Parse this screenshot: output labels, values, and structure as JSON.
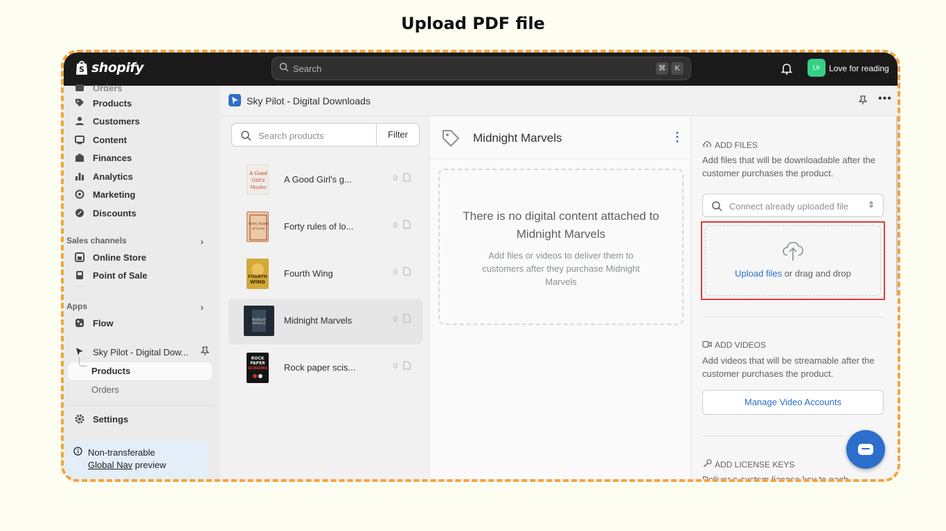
{
  "page": {
    "heading": "Upload PDF file"
  },
  "topbar": {
    "logo_text": "shopify",
    "search_placeholder": "Search",
    "shortcut_keys": [
      "⌘",
      "K"
    ],
    "store_initials": "Lfr",
    "store_name": "Love for reading",
    "icons": [
      "shopify-bag-icon",
      "search-icon",
      "bell-icon"
    ]
  },
  "sidebar": {
    "partial_top": "Orders",
    "items": [
      {
        "label": "Products",
        "icon": "tag-icon"
      },
      {
        "label": "Customers",
        "icon": "person-icon"
      },
      {
        "label": "Content",
        "icon": "content-icon"
      },
      {
        "label": "Finances",
        "icon": "bank-icon"
      },
      {
        "label": "Analytics",
        "icon": "bar-chart-icon"
      },
      {
        "label": "Marketing",
        "icon": "target-icon"
      },
      {
        "label": "Discounts",
        "icon": "discount-icon"
      }
    ],
    "sales_channels_label": "Sales channels",
    "sales_channels": [
      {
        "label": "Online Store",
        "icon": "store-icon"
      },
      {
        "label": "Point of Sale",
        "icon": "pos-icon"
      }
    ],
    "apps_label": "Apps",
    "apps": [
      {
        "label": "Flow",
        "icon": "flow-icon"
      },
      {
        "label": "Sky Pilot - Digital Dow...",
        "icon": "cursor-icon"
      }
    ],
    "app_sub_items": [
      "Products",
      "Orders"
    ],
    "settings_label": "Settings",
    "notice": {
      "line1": "Non-transferable",
      "link": "Global Nav",
      "suffix": " preview"
    }
  },
  "main": {
    "app_title": "Sky Pilot - Digital Downloads",
    "product_search_placeholder": "Search products",
    "filter_label": "Filter",
    "products": [
      {
        "name": "A Good Girl's g...",
        "count": "0",
        "cover_color": "#f1ece4"
      },
      {
        "name": "Forty rules of lo...",
        "count": "0",
        "cover_color": "#e9c9a6"
      },
      {
        "name": "Fourth Wing",
        "count": "0",
        "cover_color": "#d4a838"
      },
      {
        "name": "Midnight Marvels",
        "count": "0",
        "cover_color": "#1f2a34"
      },
      {
        "name": "Rock paper scis...",
        "count": "0",
        "cover_color": "#141414"
      }
    ],
    "selected_product": "Midnight Marvels",
    "empty_state": {
      "title": "There is no digital content attached to Midnight Marvels",
      "body": "Add files or videos to deliver them to customers after they purchase Midnight Marvels"
    }
  },
  "files": {
    "add_files_title": "ADD FILES",
    "add_files_desc": "Add files that will be downloadable after the customer purchases the product.",
    "connect_placeholder": "Connect already uploaded file",
    "upload_link": "Upload files",
    "upload_suffix": " or drag and drop",
    "add_videos_title": "ADD VIDEOS",
    "add_videos_desc": "Add videos that will be streamable after the customer purchases the product.",
    "manage_video_label": "Manage Video Accounts",
    "add_license_title": "ADD LICENSE KEYS",
    "add_license_desc": "Deliver a custom license key to each"
  },
  "colors": {
    "accent": "#2c6ecb",
    "highlight": "#e03b3b",
    "frame": "#f2a53a"
  }
}
